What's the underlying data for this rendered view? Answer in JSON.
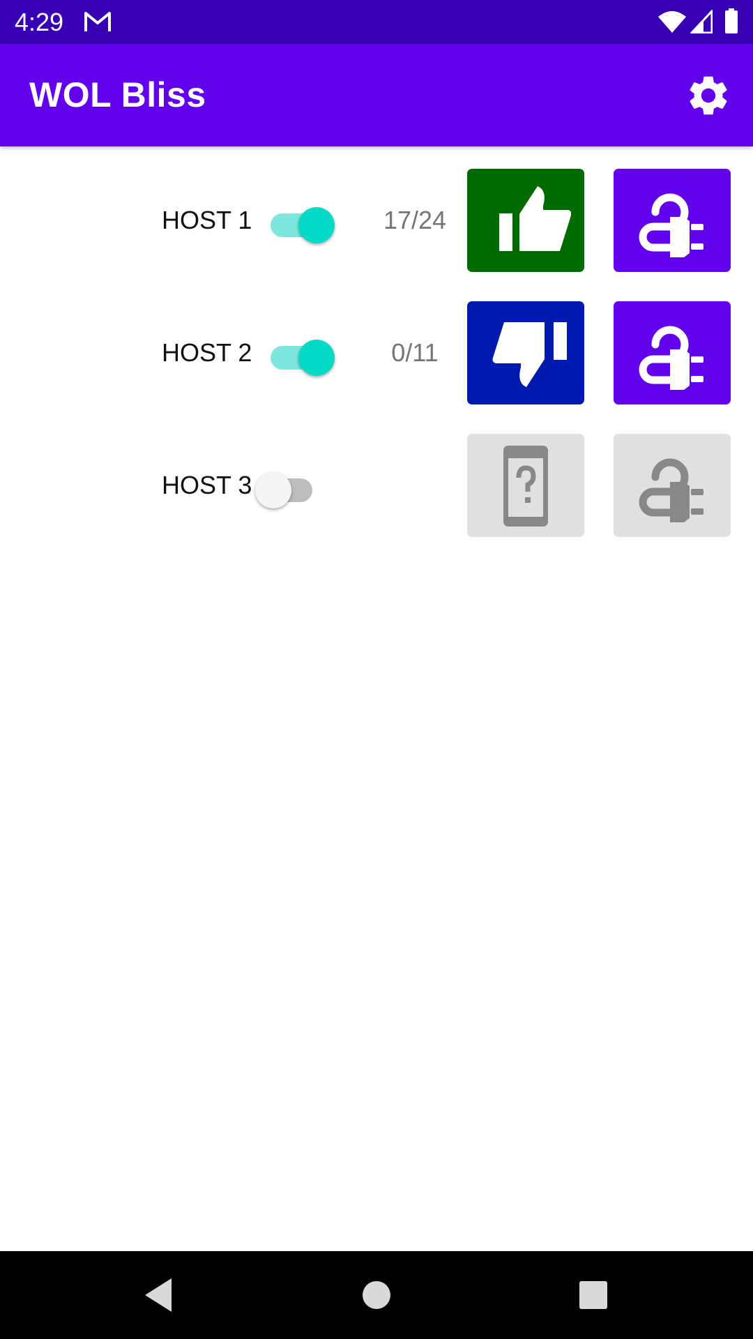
{
  "status_bar": {
    "time": "4:29",
    "notification_icon": "gmail-icon",
    "icons": [
      "wifi-icon",
      "cell-signal-icon",
      "battery-icon"
    ]
  },
  "app_bar": {
    "title": "WOL Bliss",
    "settings_icon": "gear-icon",
    "background": "#6200ee"
  },
  "hosts": [
    {
      "name": "HOST 1",
      "enabled": true,
      "count": "17/24",
      "status_icon": "thumbs-up-icon",
      "status_color": "#006b00",
      "wake_icon": "power-plug-icon",
      "wake_color": "#6200ee"
    },
    {
      "name": "HOST 2",
      "enabled": true,
      "count": "0/11",
      "status_icon": "thumbs-down-icon",
      "status_color": "#001aad",
      "wake_icon": "power-plug-icon",
      "wake_color": "#6200ee"
    },
    {
      "name": "HOST 3",
      "enabled": false,
      "count": "",
      "status_icon": "device-unknown-icon",
      "status_color": "#e0e0e0",
      "wake_icon": "power-plug-icon",
      "wake_color": "#e0e0e0"
    }
  ],
  "nav_bar": {
    "buttons": [
      "back-icon",
      "home-icon",
      "recents-icon"
    ]
  }
}
